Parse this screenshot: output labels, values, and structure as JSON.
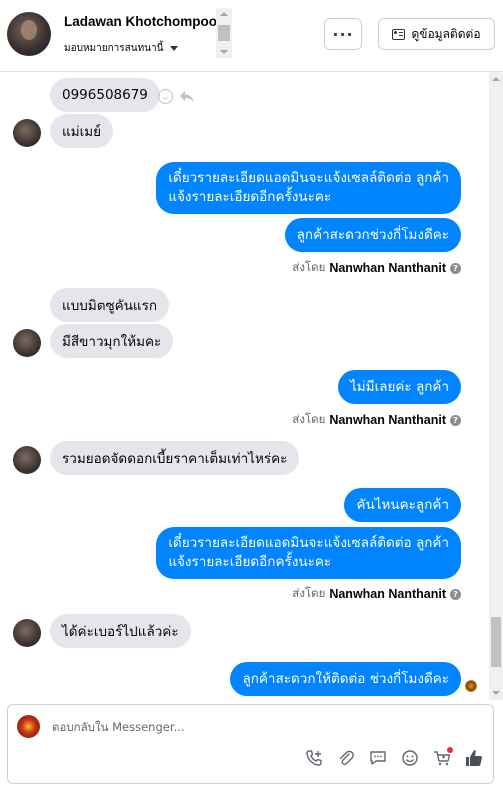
{
  "header": {
    "contact_name": "Ladawan Khotchompoo",
    "assign_label": "มอบหมายการสนทนานี้",
    "more_label": "···",
    "contact_info_label": "ดูข้อมูลติดต่อ"
  },
  "messages": {
    "m1": "0996508679",
    "m2": "แม่เมย์",
    "m3_line1": "เดี๋ยวรายละเอียดแอดมินจะแจ้งเซลล์ติดต่อ ลูกค้า",
    "m3_line2": "แจ้งรายละเอียดอีกครั้งนะคะ",
    "m4": "ลูกค้าสะดวกช่วงกี่โมงดีคะ",
    "m5": "แบบมิตซูคันแรก",
    "m6": "มีสีขาวมุกให้มคะ",
    "m7": "ไม่มีเลยค่ะ ลูกค้า",
    "m8": "รวมยอดจัดดอกเบี้ยราคาเต็มเท่าไหร่คะ",
    "m9": "คันไหนคะลูกค้า",
    "m10_line1": "เดี๋ยวรายละเอียดแอดมินจะแจ้งเซลล์ติดต่อ ลูกค้า",
    "m10_line2": "แจ้งรายละเอียดอีกครั้งนะคะ",
    "m11": "ได้ค่ะเบอร์ไปแล้วค่ะ",
    "m12": "ลูกค้าสะดวกให้ติดต่อ ช่วงกี่โมงดีคะ"
  },
  "sent_by": {
    "prefix": "ส่งโดย",
    "agent_name": "Nanwhan Nanthanit",
    "info_glyph": "?"
  },
  "composer": {
    "placeholder": "ตอบกลับใน Messenger..."
  },
  "icons": {
    "tools": [
      "phone-add-icon",
      "attachment-icon",
      "saved-replies-icon",
      "emoji-icon",
      "shop-cart-icon",
      "like-icon"
    ]
  },
  "colors": {
    "outgoing_bubble": "#0084ff",
    "incoming_bubble": "#e4e6eb",
    "notification_dot": "#f02849"
  }
}
